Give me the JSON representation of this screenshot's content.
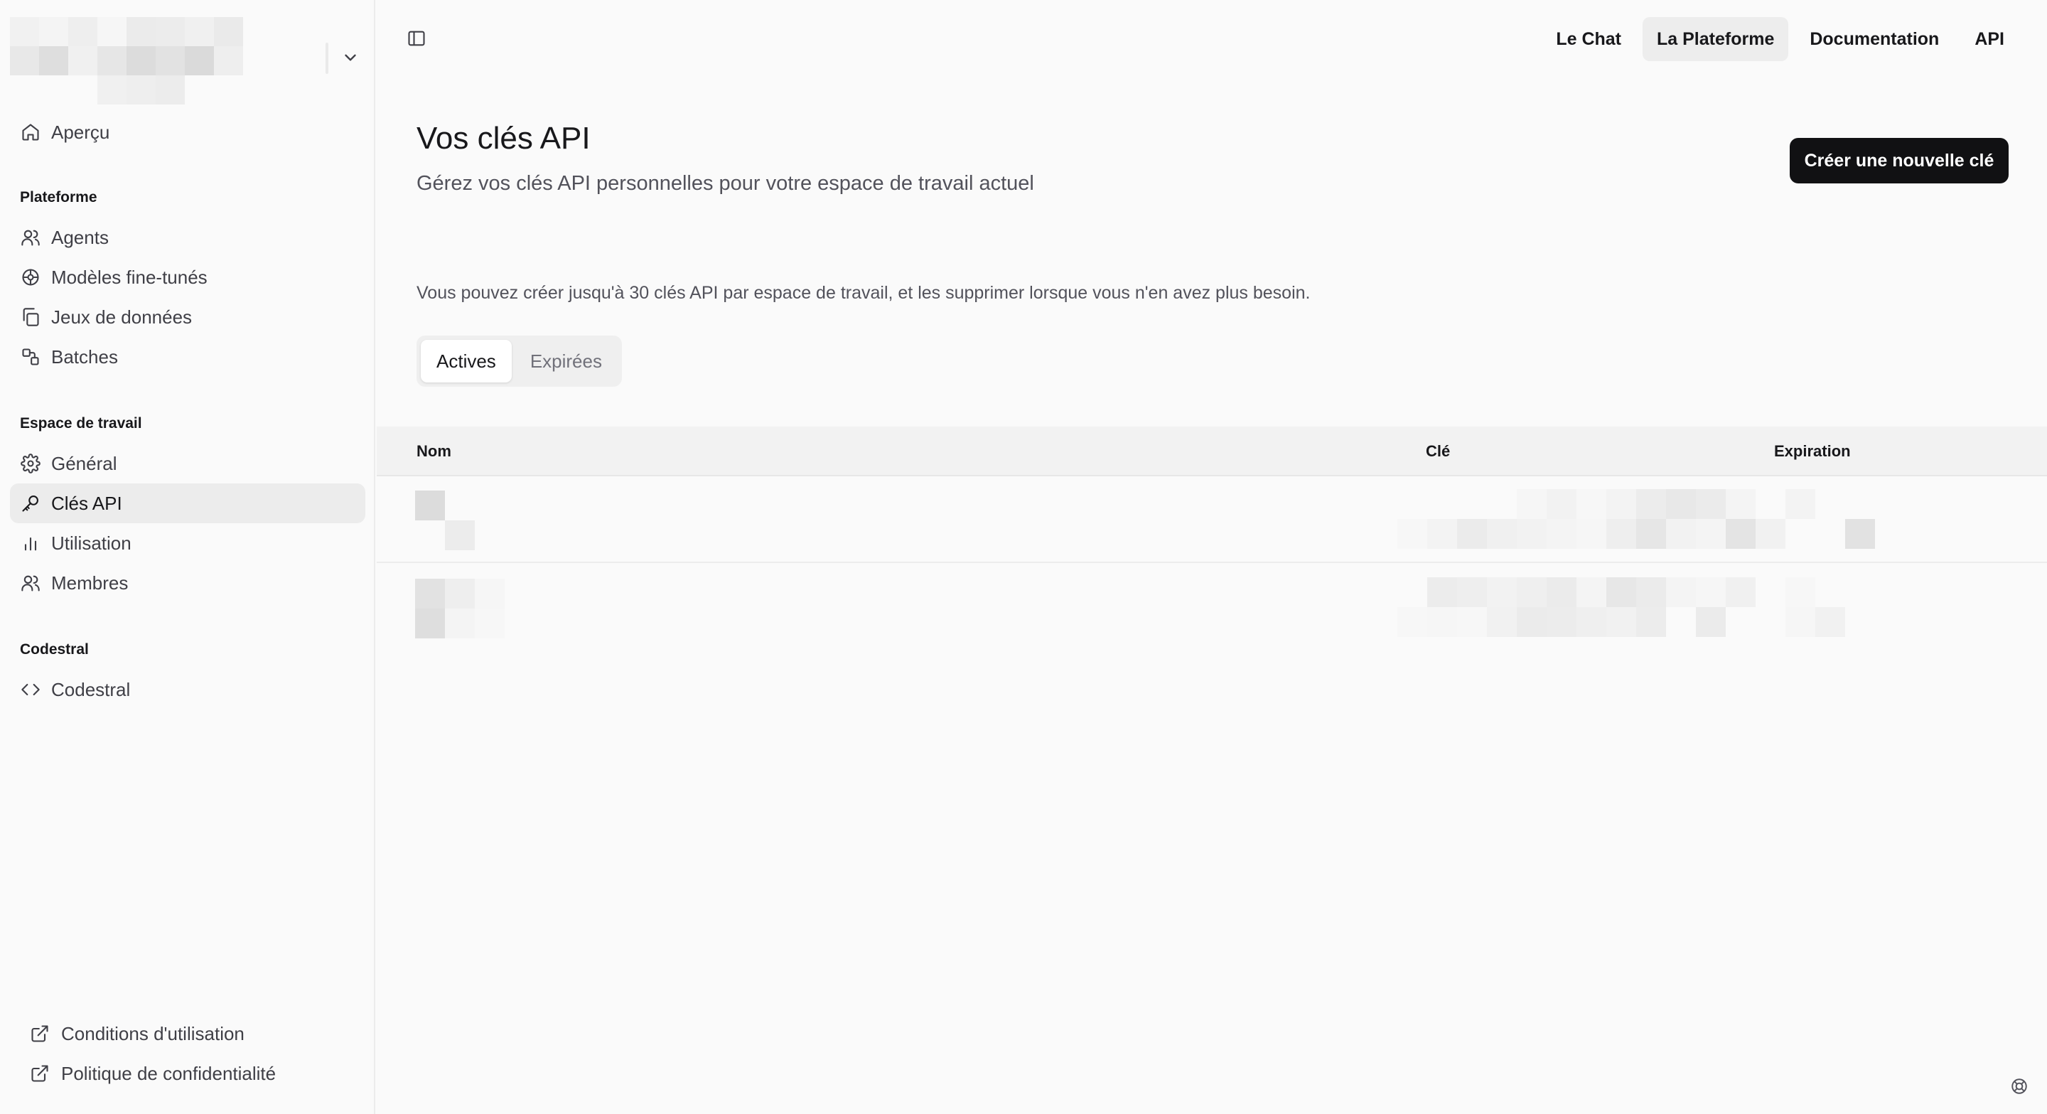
{
  "sidebar": {
    "overview": {
      "label": "Aperçu",
      "icon": "home-icon"
    },
    "sections": [
      {
        "title": "Plateforme",
        "items": [
          {
            "label": "Agents",
            "icon": "users-icon"
          },
          {
            "label": "Modèles fine-tunés",
            "icon": "model-icon"
          },
          {
            "label": "Jeux de données",
            "icon": "copy-icon"
          },
          {
            "label": "Batches",
            "icon": "batches-icon"
          }
        ]
      },
      {
        "title": "Espace de travail",
        "items": [
          {
            "label": "Général",
            "icon": "gear-icon"
          },
          {
            "label": "Clés API",
            "icon": "key-icon",
            "active": true
          },
          {
            "label": "Utilisation",
            "icon": "bar-chart-icon"
          },
          {
            "label": "Membres",
            "icon": "users-icon"
          }
        ]
      },
      {
        "title": "Codestral",
        "items": [
          {
            "label": "Codestral",
            "icon": "code-icon"
          }
        ]
      }
    ],
    "footer": [
      {
        "label": "Conditions d'utilisation",
        "icon": "external-link-icon"
      },
      {
        "label": "Politique de confidentialité",
        "icon": "external-link-icon"
      }
    ]
  },
  "topnav": {
    "items": [
      {
        "label": "Le Chat",
        "active": false
      },
      {
        "label": "La Plateforme",
        "active": true
      },
      {
        "label": "Documentation",
        "active": false
      },
      {
        "label": "API",
        "active": false
      }
    ]
  },
  "page": {
    "title": "Vos clés API",
    "subtitle": "Gérez vos clés API personnelles pour votre espace de travail actuel",
    "create_button": "Créer une nouvelle clé",
    "info": "Vous pouvez créer jusqu'à 30 clés API par espace de travail, et les supprimer lorsque vous n'en avez plus besoin."
  },
  "tabs": [
    {
      "label": "Actives",
      "active": true
    },
    {
      "label": "Expirées",
      "active": false
    }
  ],
  "table": {
    "columns": {
      "name": "Nom",
      "key": "Clé",
      "expiration": "Expiration"
    },
    "row_count": 2
  },
  "colors": {
    "primary_button": "#111113",
    "active_bg": "#ececec",
    "muted_text": "#52525b"
  }
}
